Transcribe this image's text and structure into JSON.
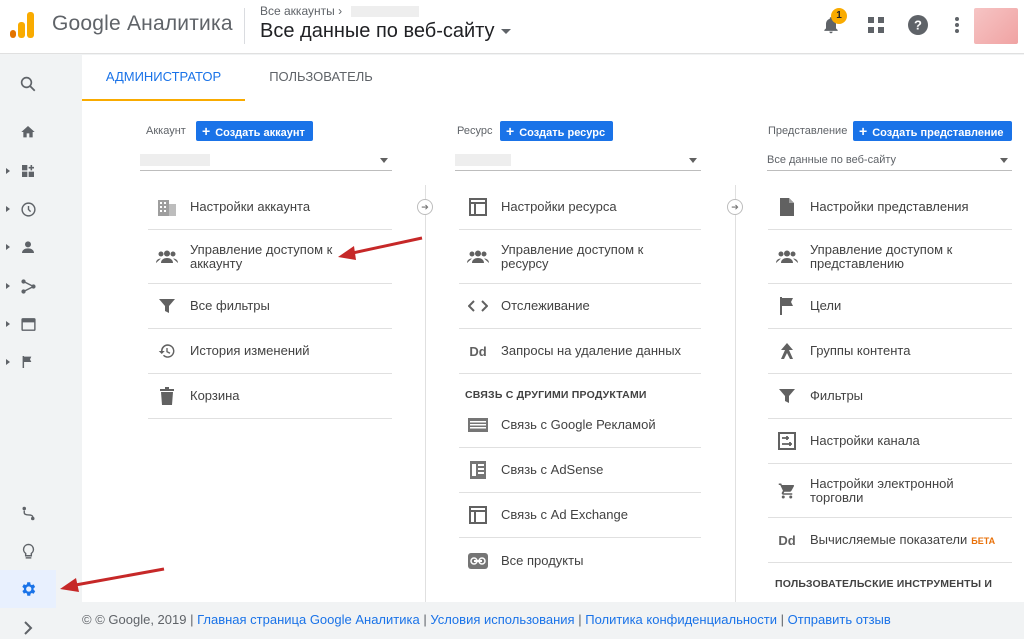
{
  "header": {
    "app_title": "Google Аналитика",
    "breadcrumb": "Все аккаунты",
    "view_selector": "Все данные по веб-сайту",
    "notification_count": "1"
  },
  "rail": {
    "items": [
      "search-icon",
      "home-icon",
      "customization-icon",
      "realtime-icon",
      "audience-icon",
      "acquisition-icon",
      "behavior-icon",
      "conversions-icon",
      "attribution-icon",
      "discover-icon",
      "admin-icon",
      "expand-icon"
    ]
  },
  "tabs": [
    {
      "label": "АДМИНИСТРАТОР",
      "active": true
    },
    {
      "label": "ПОЛЬЗОВАТЕЛЬ",
      "active": false
    }
  ],
  "account": {
    "label": "Аккаунт",
    "create_button": "Создать аккаунт",
    "items": [
      {
        "label": "Настройки аккаунта",
        "icon": "building-icon"
      },
      {
        "label": "Управление доступом к аккаунту",
        "icon": "people-icon"
      },
      {
        "label": "Все фильтры",
        "icon": "filter-icon"
      },
      {
        "label": "История изменений",
        "icon": "history-icon"
      },
      {
        "label": "Корзина",
        "icon": "trash-icon"
      }
    ]
  },
  "property": {
    "label": "Ресурс",
    "create_button": "Создать ресурс",
    "items": [
      {
        "label": "Настройки ресурса",
        "icon": "property-settings-icon"
      },
      {
        "label": "Управление доступом к ресурсу",
        "icon": "people-icon"
      },
      {
        "label": "Отслеживание",
        "icon": "code-icon"
      },
      {
        "label": "Запросы на удаление данных",
        "icon": "dd-icon"
      }
    ],
    "section_title": "СВЯЗЬ С ДРУГИМИ ПРОДУКТАМИ",
    "links": [
      {
        "label": "Связь с Google Рекламой",
        "icon": "ads-icon"
      },
      {
        "label": "Связь с AdSense",
        "icon": "adsense-icon"
      },
      {
        "label": "Связь с Ad Exchange",
        "icon": "adexchange-icon"
      },
      {
        "label": "Все продукты",
        "icon": "link-icon"
      }
    ]
  },
  "view": {
    "label": "Представление",
    "create_button": "Создать представление",
    "selected": "Все данные по веб-сайту",
    "items": [
      {
        "label": "Настройки представления",
        "icon": "document-icon"
      },
      {
        "label": "Управление доступом к представлению",
        "icon": "people-icon"
      },
      {
        "label": "Цели",
        "icon": "flag-icon"
      },
      {
        "label": "Группы контента",
        "icon": "content-group-icon"
      },
      {
        "label": "Фильтры",
        "icon": "filter-icon"
      },
      {
        "label": "Настройки канала",
        "icon": "channel-icon"
      },
      {
        "label": "Настройки электронной торговли",
        "icon": "cart-icon"
      },
      {
        "label": "Вычисляемые показатели",
        "icon": "dd-icon",
        "badge": "БЕТА"
      }
    ],
    "section_title": "ПОЛЬЗОВАТЕЛЬСКИЕ ИНСТРУМЕНТЫ И"
  },
  "footer": {
    "copyright": "© Google, 2019",
    "links": [
      "Главная страница Google Аналитика",
      "Условия использования",
      "Политика конфиденциальности",
      "Отправить отзыв"
    ]
  },
  "colors": {
    "accent": "#1a73e8",
    "brand_orange": "#f9ab00",
    "annotation_red": "#c62828"
  }
}
